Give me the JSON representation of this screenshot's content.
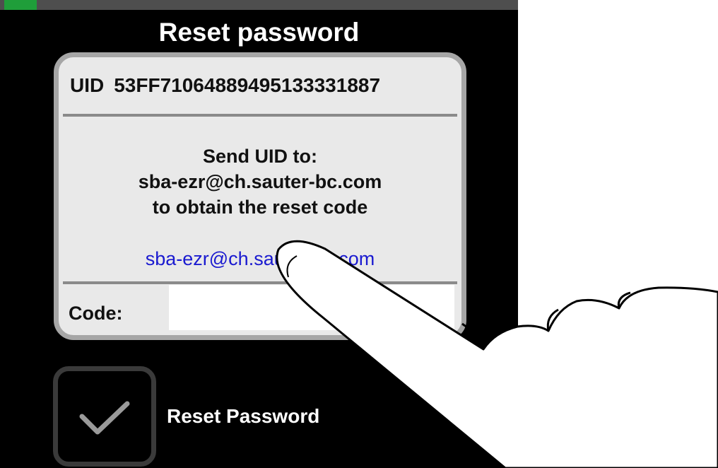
{
  "dialog": {
    "title": "Reset password"
  },
  "uid": {
    "label": "UID",
    "value": "53FF71064889495133331887"
  },
  "instructions": {
    "line1": "Send UID to:",
    "line2": "sba-ezr@ch.sauter-bc.com",
    "line3": "to obtain the reset code"
  },
  "email_link": {
    "text": "sba-ezr@ch.sauter-bc.com"
  },
  "code_field": {
    "label": "Code:",
    "value": ""
  },
  "reset_button": {
    "label": "Reset Password",
    "icon": "checkmark-icon"
  },
  "colors": {
    "background": "#000000",
    "panel": "#e9e9e9",
    "panel_border": "#a6a6a6",
    "link": "#1a1ad0",
    "status_led": "#1f9e3a"
  }
}
